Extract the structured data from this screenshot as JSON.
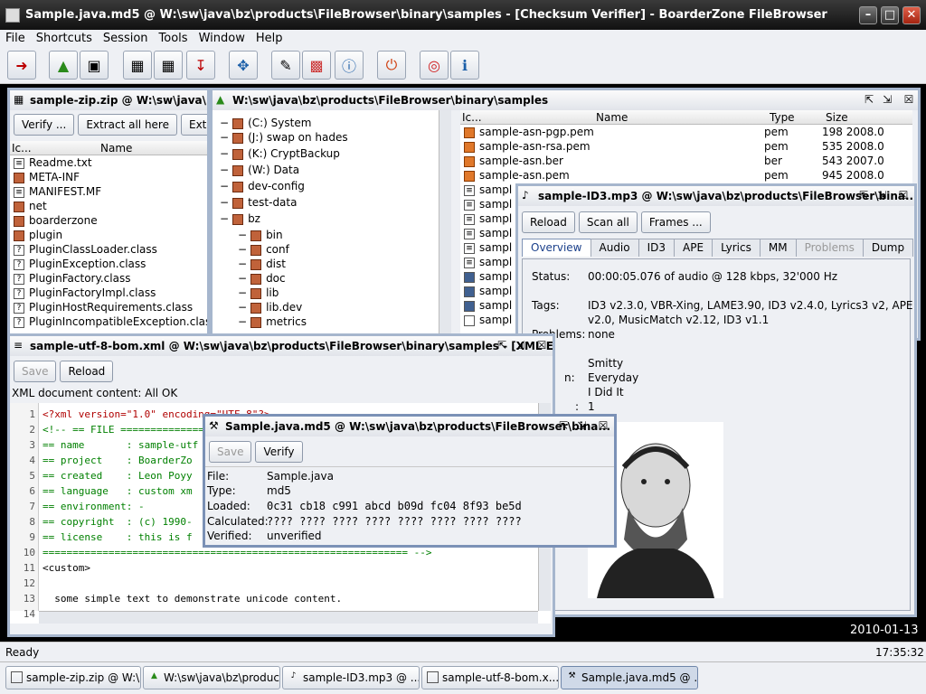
{
  "window": {
    "title": "Sample.java.md5 @ W:\\sw\\java\\bz\\products\\FileBrowser\\binary\\samples - [Checksum Verifier] - BoarderZone FileBrowser"
  },
  "menu": [
    "File",
    "Shortcuts",
    "Session",
    "Tools",
    "Window",
    "Help"
  ],
  "zip": {
    "title": "sample-zip.zip @ W:\\sw\\java\\bz\\products\\FileBrowser\\binary\\samples",
    "buttons": [
      "Verify ...",
      "Extract all here",
      "Extract all ..."
    ],
    "columns": [
      "Ic...",
      "Name"
    ],
    "rows": [
      "Readme.txt",
      "META-INF",
      "MANIFEST.MF",
      "net",
      "boarderzone",
      "plugin",
      "PluginClassLoader.class",
      "PluginException.class",
      "PluginFactory.class",
      "PluginFactoryImpl.class",
      "PluginHostRequirements.class",
      "PluginIncompatibleException.class"
    ]
  },
  "browser": {
    "title": "W:\\sw\\java\\bz\\products\\FileBrowser\\binary\\samples",
    "tree": [
      "(C:) System",
      "(J:) swap on hades",
      "(K:) CryptBackup",
      "(W:) Data",
      "dev-config",
      "test-data",
      "bz",
      "bin",
      "conf",
      "dist",
      "doc",
      "lib",
      "lib.dev",
      "metrics"
    ],
    "columns": [
      "Ic...",
      "Name",
      "Type",
      "Size"
    ],
    "files": [
      {
        "name": "sample-asn-pgp.pem",
        "type": "pem",
        "size": "198 2008.0"
      },
      {
        "name": "sample-asn-rsa.pem",
        "type": "pem",
        "size": "535 2008.0"
      },
      {
        "name": "sample-asn.ber",
        "type": "ber",
        "size": "543 2007.0"
      },
      {
        "name": "sample-asn.pem",
        "type": "pem",
        "size": "945 2008.0"
      }
    ],
    "more_files": [
      "sampl",
      "sampl",
      "sampl",
      "sampl",
      "sampl",
      "sampl",
      "sampl",
      "sampl",
      "sampl",
      "sampl"
    ]
  },
  "id3": {
    "title": "sample-ID3.mp3 @ W:\\sw\\java\\bz\\products\\FileBrowser\\bina...",
    "buttons": [
      "Reload",
      "Scan all",
      "Frames ..."
    ],
    "tabs": [
      "Overview",
      "Audio",
      "ID3",
      "APE",
      "Lyrics",
      "MM",
      "Problems",
      "Dump"
    ],
    "status_label": "Status:",
    "status": "00:00:05.076 of audio @ 128 kbps, 32'000 Hz",
    "tags_label": "Tags:",
    "tags": "ID3 v2.3.0, VBR-Xing, LAME3.90, ID3 v2.4.0, Lyrics3 v2, APE",
    "tags2": "v2.0, MusicMatch v2.12, ID3 v1.1",
    "problems_label": "Problems:",
    "problems": "none",
    "artist": "Smitty",
    "label_n": "n:",
    "album": "Everyday",
    "song": "I Did It",
    "label_colon": ":",
    "track": "1"
  },
  "xml": {
    "title": "sample-utf-8-bom.xml @ W:\\sw\\java\\bz\\products\\FileBrowser\\binary\\samples - [XML Edi...",
    "buttons": [
      "Save",
      "Reload"
    ],
    "status": "XML document content:   All OK",
    "lines": [
      {
        "n": "1",
        "t": "<?xml version=\"1.0\" encoding=\"UTF-8\"?>"
      },
      {
        "n": "2",
        "t": "<!-- == FILE ================"
      },
      {
        "n": "3",
        "t": "== name       : sample-utf"
      },
      {
        "n": "4",
        "t": "== project    : BoarderZo"
      },
      {
        "n": "5",
        "t": "== created    : Leon Poyy"
      },
      {
        "n": "6",
        "t": "== language   : custom xm"
      },
      {
        "n": "7",
        "t": "== environment: -"
      },
      {
        "n": "8",
        "t": "== copyright  : (c) 1990-"
      },
      {
        "n": "9",
        "t": "== license    : this is f"
      },
      {
        "n": "10",
        "t": "============================================================= -->"
      },
      {
        "n": "11",
        "t": "<custom>"
      },
      {
        "n": "12",
        "t": ""
      },
      {
        "n": "13",
        "t": "  some simple text to demonstrate unicode content."
      },
      {
        "n": "14",
        "t": ""
      }
    ]
  },
  "md5": {
    "title": "Sample.java.md5 @ W:\\sw\\java\\bz\\products\\FileBrowser\\bina...",
    "buttons": [
      "Save",
      "Verify"
    ],
    "file_label": "File:",
    "file": "Sample.java",
    "type_label": "Type:",
    "type": "md5",
    "loaded_label": "Loaded:",
    "loaded": "0c31 cb18 c991 abcd b09d fc04 8f93 be5d",
    "calc_label": "Calculated:",
    "calc": "???? ???? ???? ???? ???? ???? ???? ????",
    "verified_label": "Verified:",
    "verified": "unverified"
  },
  "desktop_date": "2010-01-13",
  "status": {
    "text": "Ready",
    "time": "17:35:32"
  },
  "taskbar": [
    "sample-zip.zip @ W:\\...",
    "W:\\sw\\java\\bz\\produc...",
    "sample-ID3.mp3 @ ...",
    "sample-utf-8-bom.x...",
    "Sample.java.md5 @ ..."
  ],
  "colors": {
    "accent": "#7b91b6",
    "xml_tag": "#b00000",
    "xml_comment": "#008000",
    "tab_selected": "#1a3f8a"
  }
}
